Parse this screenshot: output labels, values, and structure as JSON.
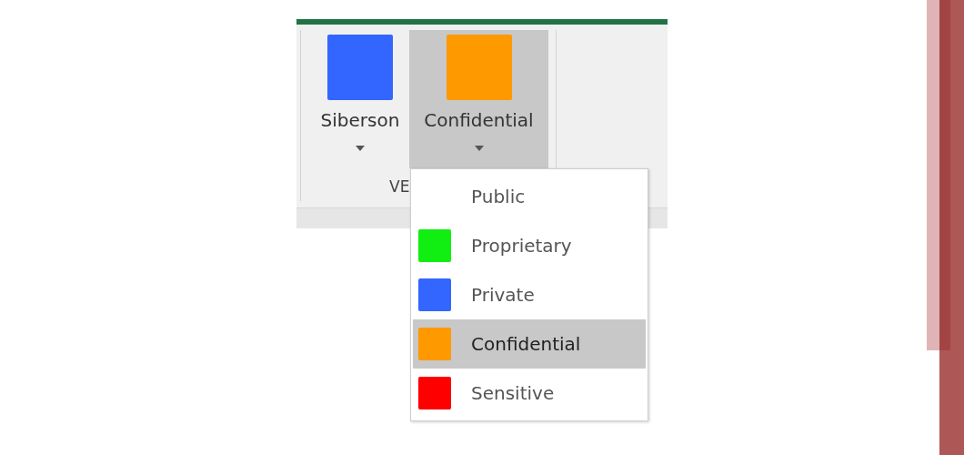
{
  "ribbon": {
    "buttons": [
      {
        "label": "Siberson",
        "color": "#3366ff",
        "selected": false
      },
      {
        "label": "Confidential",
        "color": "#ff9900",
        "selected": true
      }
    ],
    "group_label": "VE"
  },
  "menu": {
    "items": [
      {
        "label": "Public",
        "selected": false
      },
      {
        "label": "Proprietary",
        "color": "#11ee11",
        "selected": false
      },
      {
        "label": "Private",
        "color": "#3366ff",
        "selected": false
      },
      {
        "label": "Confidential",
        "color": "#ff9900",
        "selected": true
      },
      {
        "label": "Sensitive",
        "color": "#ff0000",
        "selected": false
      }
    ]
  }
}
